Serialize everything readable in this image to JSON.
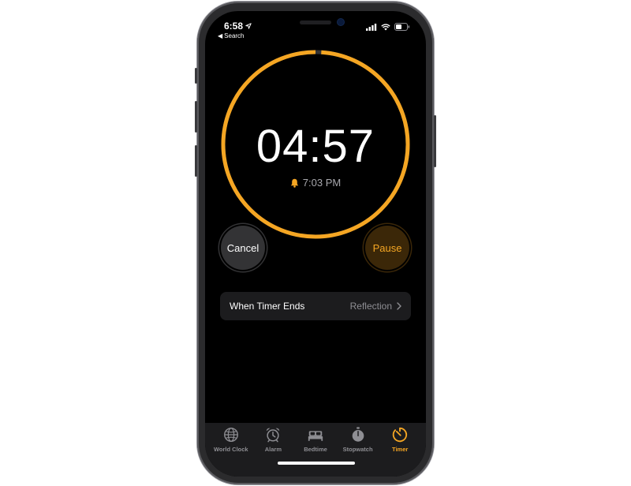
{
  "status_bar": {
    "time": "6:58",
    "back_label": "Search"
  },
  "timer": {
    "remaining": "04:57",
    "end_time": "7:03 PM",
    "progress_fraction": 0.99,
    "ring_color": "#f5a623"
  },
  "buttons": {
    "cancel_label": "Cancel",
    "pause_label": "Pause"
  },
  "settings": {
    "when_timer_ends_label": "When Timer Ends",
    "sound_value": "Reflection"
  },
  "tabbar": {
    "tabs": [
      {
        "label": "World Clock",
        "icon": "globe-icon",
        "active": false
      },
      {
        "label": "Alarm",
        "icon": "alarm-clock-icon",
        "active": false
      },
      {
        "label": "Bedtime",
        "icon": "bed-icon",
        "active": false
      },
      {
        "label": "Stopwatch",
        "icon": "stopwatch-icon",
        "active": false
      },
      {
        "label": "Timer",
        "icon": "timer-icon",
        "active": true
      }
    ]
  },
  "colors": {
    "accent": "#f5a623",
    "background": "#000000",
    "row_background": "#1c1c1e"
  }
}
